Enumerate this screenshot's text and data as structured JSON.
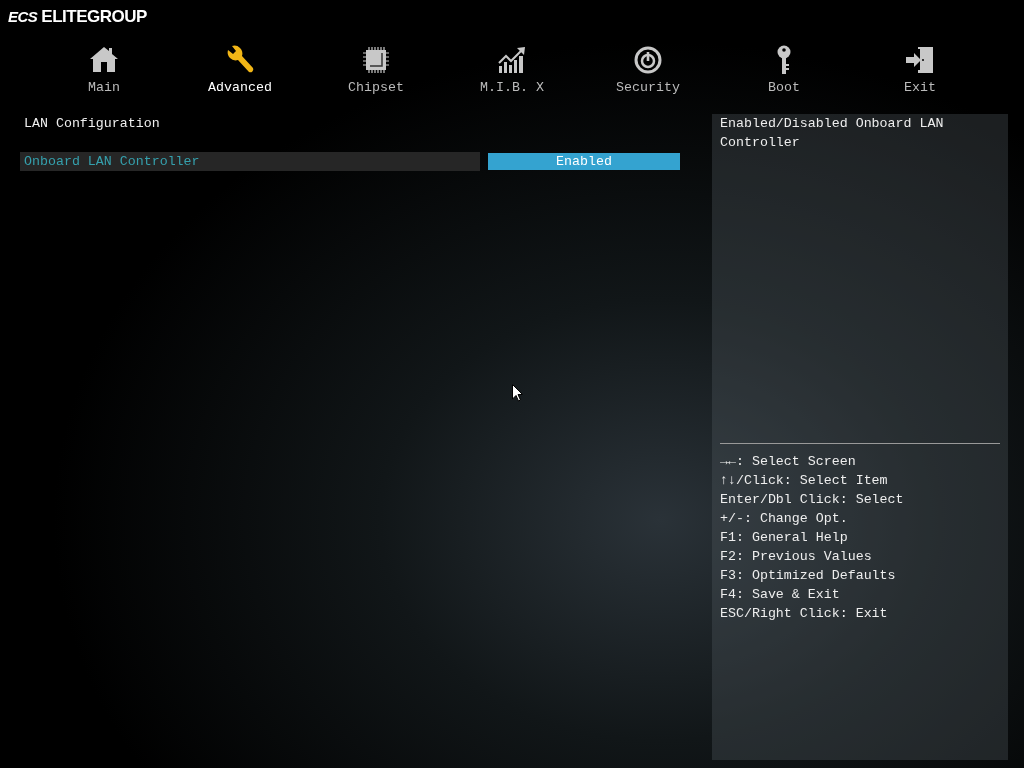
{
  "brand": {
    "logo": "ECS",
    "name": "ELITEGROUP"
  },
  "tabs": [
    {
      "label": "Main",
      "kind": "house",
      "selected": false
    },
    {
      "label": "Advanced",
      "kind": "wrench",
      "selected": true
    },
    {
      "label": "Chipset",
      "kind": "chip",
      "selected": false
    },
    {
      "label": "M.I.B. X",
      "kind": "chart",
      "selected": false
    },
    {
      "label": "Security",
      "kind": "power",
      "selected": false
    },
    {
      "label": "Boot",
      "kind": "key",
      "selected": false
    },
    {
      "label": "Exit",
      "kind": "door",
      "selected": false
    }
  ],
  "page_title": "LAN Configuration",
  "settings": [
    {
      "label": "Onboard LAN Controller",
      "value": "Enabled",
      "selected": true
    }
  ],
  "help_text": "Enabled/Disabled Onboard LAN Controller",
  "key_help": [
    "→←: Select Screen",
    "↑↓/Click: Select Item",
    "Enter/Dbl Click: Select",
    "+/-: Change Opt.",
    "F1: General Help",
    "F2: Previous Values",
    "F3: Optimized Defaults",
    "F4: Save & Exit",
    "ESC/Right Click: Exit"
  ]
}
